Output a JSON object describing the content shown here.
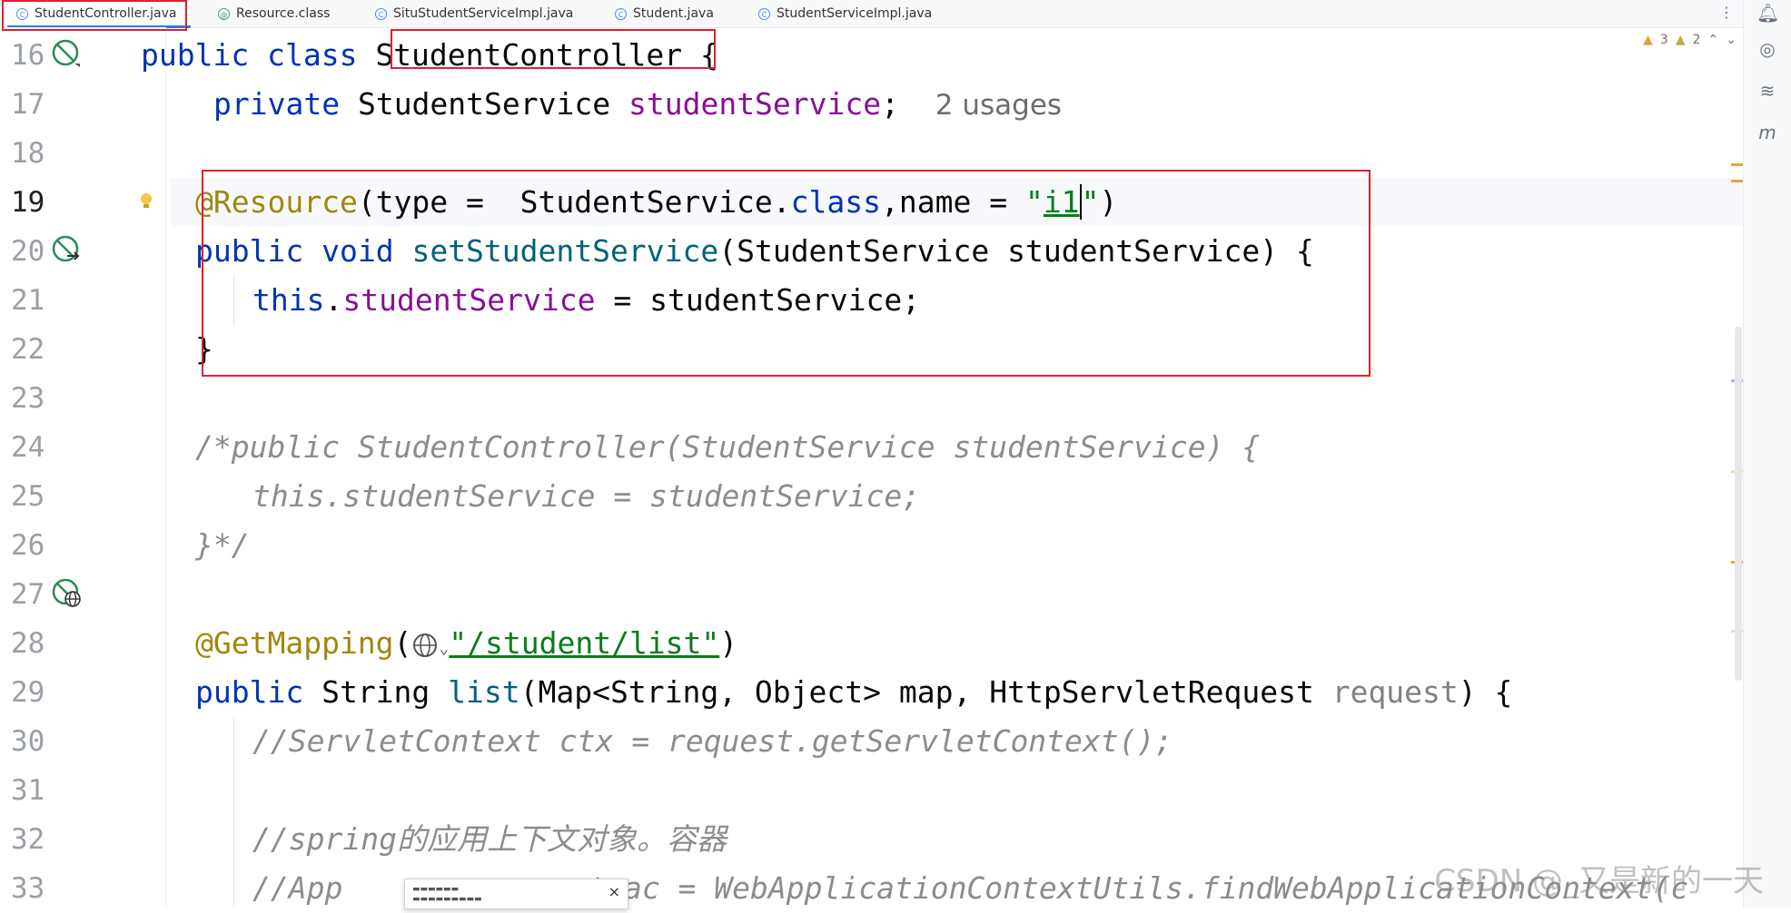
{
  "tabs": [
    {
      "label": "StudentController.java",
      "icon": "class-icon",
      "active": true
    },
    {
      "label": "Resource.class",
      "icon": "annotation-icon",
      "active": false
    },
    {
      "label": "SituStudentServiceImpl.java",
      "icon": "class-icon",
      "active": false
    },
    {
      "label": "Student.java",
      "icon": "class-icon",
      "active": false
    },
    {
      "label": "StudentServiceImpl.java",
      "icon": "class-icon",
      "active": false
    }
  ],
  "inspections": {
    "warnings": "3",
    "weak_warnings": "2"
  },
  "line_numbers": [
    "16",
    "17",
    "18",
    "19",
    "20",
    "21",
    "22",
    "23",
    "24",
    "25",
    "26",
    "27",
    "28",
    "29",
    "30",
    "31",
    "32",
    "33"
  ],
  "code": {
    "l16": {
      "kw1": "public",
      "kw2": "class",
      "name": "StudentController",
      "brace": " {"
    },
    "l17": {
      "kw": "private",
      "type": "StudentService",
      "field": "studentService",
      "semi": ";",
      "hint": "2 usages"
    },
    "l19": {
      "ann": "@Resource",
      "p1": "(type =  StudentService.",
      "kw": "class",
      "p2": ",name = ",
      "str_open": "\"",
      "str_val": "i1",
      "str_close": "\"",
      "p3": ")"
    },
    "l20": {
      "kw1": "public",
      "kw2": "void",
      "method": "setStudentService",
      "rest": "(StudentService studentService) {"
    },
    "l21": {
      "kw": "this",
      "dot": ".",
      "field": "studentService",
      "rest": " = studentService;"
    },
    "l22": {
      "brace": "}"
    },
    "l24": {
      "comment": "/*public StudentController(StudentService studentService) {"
    },
    "l25": {
      "comment": "this.studentService = studentService;"
    },
    "l26": {
      "comment": "}*/"
    },
    "l28": {
      "ann": "@GetMapping",
      "open": "(",
      "str": "\"/student/list\"",
      "close": ")"
    },
    "l29": {
      "kw": "public",
      "type": " String ",
      "method": "list",
      "p1": "(Map<String, Object> map, HttpServletRequest ",
      "param": "request",
      "p2": ") {"
    },
    "l30": {
      "comment": "//ServletContext ctx = request.getServletContext();"
    },
    "l32": {
      "comment": "//spring的应用上下文对象。容器"
    },
    "l33": {
      "comment_a": "//App",
      "comment_b": "xt ac = WebApplicationContextUtils.findWebApplicationContext(c"
    }
  },
  "watermark": "CSDN @_又是新的一天",
  "colors": {
    "keyword": "#0033b3",
    "field": "#871094",
    "annotation": "#9e880d",
    "string": "#067d17",
    "method": "#00627a",
    "comment": "#8c8c8c",
    "highlight_box": "#e0202c",
    "active_tab_underline": "#3574f0"
  }
}
